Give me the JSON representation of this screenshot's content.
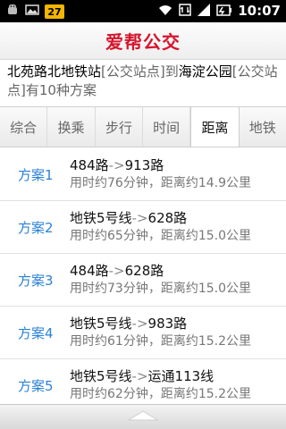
{
  "status_bar": {
    "notification_badge": "27",
    "time": "10:07",
    "icons": [
      "android-debug-icon",
      "image-icon",
      "wifi-icon",
      "mobile-data-icon",
      "signal-icon",
      "battery-icon"
    ]
  },
  "header": {
    "title": "爱帮公交",
    "title_color": "#d6152c"
  },
  "route": {
    "from": "北苑路北地铁站",
    "from_tag": "[公交站点]",
    "to_word": "到",
    "to": "海淀公园",
    "to_tag": "[公交站点]",
    "summary": "有10种方案"
  },
  "tabs": [
    {
      "label": "综合",
      "active": false
    },
    {
      "label": "换乘",
      "active": false
    },
    {
      "label": "步行",
      "active": false
    },
    {
      "label": "时间",
      "active": false
    },
    {
      "label": "距离",
      "active": true
    },
    {
      "label": "地铁",
      "active": false
    }
  ],
  "plans": [
    {
      "label": "方案1",
      "route_a": "484路",
      "arrow": "->",
      "route_b": "913路",
      "time_prefix": "用时约",
      "time": "76分钟",
      "dist_prefix": "，距离约",
      "distance": "14.9公里"
    },
    {
      "label": "方案2",
      "route_a": "地铁5号线",
      "arrow": "->",
      "route_b": "628路",
      "time_prefix": "用时约",
      "time": "65分钟",
      "dist_prefix": "，距离约",
      "distance": "15.0公里"
    },
    {
      "label": "方案3",
      "route_a": "484路",
      "arrow": "->",
      "route_b": "628路",
      "time_prefix": "用时约",
      "time": "73分钟",
      "dist_prefix": "，距离约",
      "distance": "15.0公里"
    },
    {
      "label": "方案4",
      "route_a": "地铁5号线",
      "arrow": "->",
      "route_b": "983路",
      "time_prefix": "用时约",
      "time": "61分钟",
      "dist_prefix": "，距离约",
      "distance": "15.2公里"
    },
    {
      "label": "方案5",
      "route_a": "地铁5号线",
      "arrow": "->",
      "route_b": "运通113线",
      "time_prefix": "用时约",
      "time": "62分钟",
      "dist_prefix": "，距离约",
      "distance": "15.2公里"
    }
  ],
  "colors": {
    "accent_blue": "#2a82d6",
    "brand_red": "#d6152c"
  }
}
